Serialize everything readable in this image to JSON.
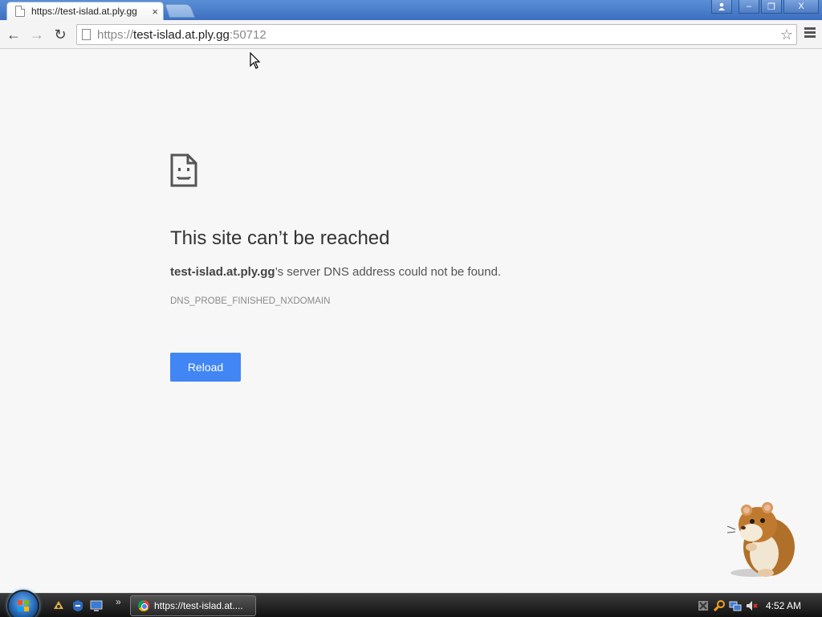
{
  "browser": {
    "tab": {
      "title": "https://test-islad.at.ply.gg",
      "close_glyph": "×"
    },
    "window_buttons": {
      "user": "user-icon",
      "minimize": "–",
      "restore": "❐",
      "close": "X"
    },
    "nav": {
      "back": "←",
      "forward": "→",
      "reload": "↻"
    },
    "address": {
      "scheme": "https://",
      "host": "test-islad.at.ply.gg",
      "port": ":50712"
    },
    "bookmark_glyph": "☆"
  },
  "error_page": {
    "icon": "sad-page-icon",
    "heading": "This site can’t be reached",
    "host": "test-islad.at.ply.gg",
    "message_suffix": "’s server DNS address could not be found.",
    "error_code": "DNS_PROBE_FINISHED_NXDOMAIN",
    "reload_label": "Reload",
    "accent_color": "#4285f4"
  },
  "taskbar": {
    "start": "windows-start-orb",
    "quicklaunch": [
      "quick-launch-icon-1",
      "quick-launch-icon-2",
      "quick-launch-icon-3"
    ],
    "more": "»",
    "window_item": "https://test-islad.at....",
    "clock": "4:52 AM"
  }
}
